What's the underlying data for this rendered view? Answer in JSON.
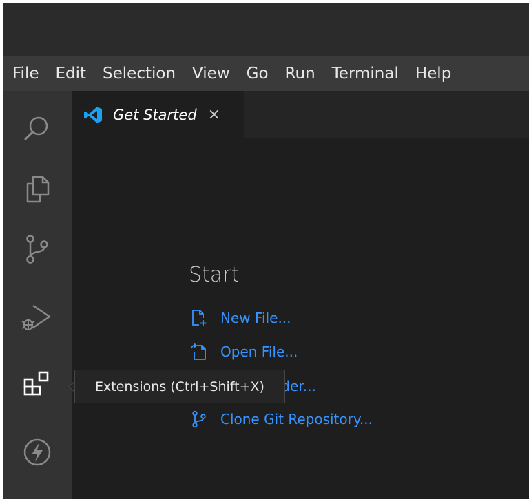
{
  "menu": {
    "items": [
      "File",
      "Edit",
      "Selection",
      "View",
      "Go",
      "Run",
      "Terminal",
      "Help"
    ]
  },
  "activity_bar": {
    "items": [
      {
        "icon": "search-icon"
      },
      {
        "icon": "explorer-files-icon"
      },
      {
        "icon": "source-control-icon"
      },
      {
        "icon": "run-debug-icon"
      },
      {
        "icon": "extensions-icon"
      },
      {
        "icon": "lightning-icon"
      }
    ]
  },
  "tab": {
    "label": "Get Started",
    "close": "×",
    "icon": "vscode-logo-icon"
  },
  "start": {
    "title": "Start",
    "new_file": "New File...",
    "open_file": "Open File...",
    "open_folder": "Open Folder...",
    "clone_repo": "Clone Git Repository..."
  },
  "tooltip": {
    "text": "Extensions (Ctrl+Shift+X)"
  },
  "colors": {
    "link": "#3794ff",
    "icon": "#8a8a8a",
    "editor_bg": "#1e1e1e",
    "vscode_blue": "#1ba1f2"
  }
}
